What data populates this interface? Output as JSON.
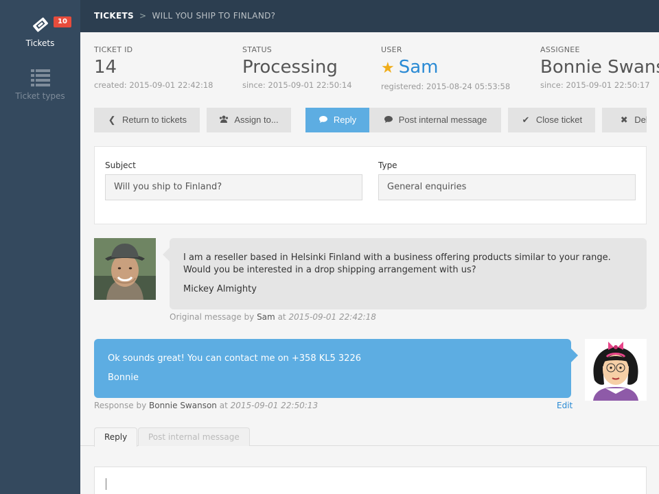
{
  "sidebar": {
    "tickets_label": "Tickets",
    "tickets_badge": "10",
    "ticket_types_label": "Ticket types"
  },
  "breadcrumb": {
    "root": "TICKETS",
    "separator": ">",
    "current": "WILL YOU SHIP TO FINLAND?"
  },
  "ticket": {
    "id_label": "TICKET ID",
    "id": "14",
    "created": "created: 2015-09-01 22:42:18",
    "status_label": "STATUS",
    "status": "Processing",
    "status_since": "since: 2015-09-01 22:50:14",
    "user_label": "USER",
    "user": "Sam",
    "user_registered": "registered: 2015-08-24 05:53:58",
    "assignee_label": "ASSIGNEE",
    "assignee": "Bonnie Swanson",
    "assignee_since": "since: 2015-09-01 22:50:17"
  },
  "actions": {
    "return": "Return to tickets",
    "assign": "Assign to...",
    "reply": "Reply",
    "internal": "Post internal message",
    "close": "Close ticket",
    "delete": "Delete"
  },
  "form": {
    "subject_label": "Subject",
    "subject_value": "Will you ship to Finland?",
    "type_label": "Type",
    "type_value": "General enquiries"
  },
  "messages": [
    {
      "text": "I am a reseller based in Helsinki Finland with a business offering products similar to your range. Would you be interested in a drop shipping arrangement with us?",
      "signature": "Mickey Almighty",
      "meta_prefix": "Original message by",
      "author": "Sam",
      "meta_at": "at",
      "time": "2015-09-01 22:42:18"
    },
    {
      "text": "Ok sounds great! You can contact me on +358 KL5 3226",
      "signature": "Bonnie",
      "meta_prefix": "Response by",
      "author": "Bonnie Swanson",
      "meta_at": "at",
      "time": "2015-09-01 22:50:13",
      "edit_label": "Edit"
    }
  ],
  "tabs": {
    "reply": "Reply",
    "internal": "Post internal message"
  },
  "colors": {
    "sidebar": "#34495e",
    "topbar": "#2c3e50",
    "accent": "#5dade2",
    "link": "#2a8ad4",
    "badge": "#e74c3c",
    "star": "#f0ad1a"
  }
}
